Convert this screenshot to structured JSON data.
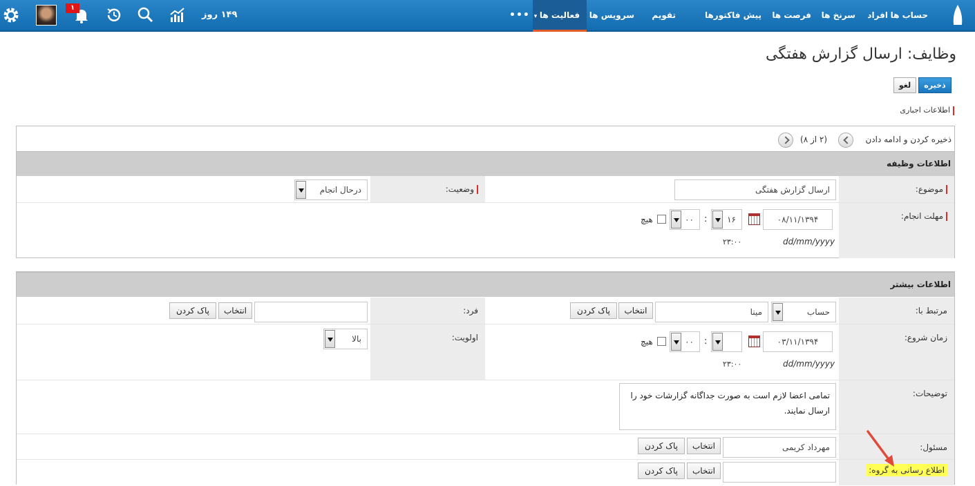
{
  "nav": {
    "items": [
      "حساب ها",
      "افراد",
      "سرنخ ها",
      "فرصت ها",
      "پیش فاکتورها",
      "تقویم",
      "سرویس ها",
      "فعالیت ها"
    ],
    "more": "•••",
    "days": "۱۴۹ روز",
    "notification_count": "۱",
    "icons": [
      "logo-icon",
      "chart-icon",
      "search-icon",
      "history-icon",
      "bell-icon",
      "avatar",
      "gear-icon"
    ],
    "accent_color": "#1a75bd",
    "active_underline": "#e2592a"
  },
  "page": {
    "title": "وظایف: ارسال گزارش هفتگی",
    "save_label": "ذخیره",
    "cancel_label": "لغو",
    "required_note": "اطلاعات اجباری"
  },
  "task_panel": {
    "save_continue": "ذخیره کردن و ادامه دادن",
    "paging": "(۲ از ۸)",
    "section_title": "اطلاعات وظیفه",
    "subject_label": "موضوع:",
    "subject_value": "ارسال گزارش هفتگی",
    "status_label": "وضعیت:",
    "status_value": "درحال انجام",
    "due_label": "مهلت انجام:",
    "due_date": "۰۸/۱۱/۱۳۹۴",
    "due_hour": "۱۶",
    "due_minute": "۰۰",
    "none_label": "هیچ",
    "date_format": "dd/mm/yyyy",
    "time_hint": "۲۳:۰۰"
  },
  "more_panel": {
    "section_title": "اطلاعات بیشتر",
    "related_label": "مرتبط با:",
    "related_type": "حساب",
    "related_value": "مینا",
    "select_label": "انتخاب",
    "clear_label": "پاک کردن",
    "person_label": "فرد:",
    "person_value": "",
    "start_label": "زمان شروع:",
    "start_date": "۰۳/۱۱/۱۳۹۴",
    "start_hour": "",
    "start_minute": "۰۰",
    "priority_label": "اولویت:",
    "priority_value": "بالا",
    "desc_label": "توضیحات:",
    "desc_value": "تمامی اعضا لازم است به صورت جداگانه گزارشات خود را ارسال نمایند.",
    "owner_label": "مسئول:",
    "owner_value": "مهرداد کریمی",
    "notify_label": "اطلاع رسانی به گروه:",
    "notify_value": ""
  }
}
